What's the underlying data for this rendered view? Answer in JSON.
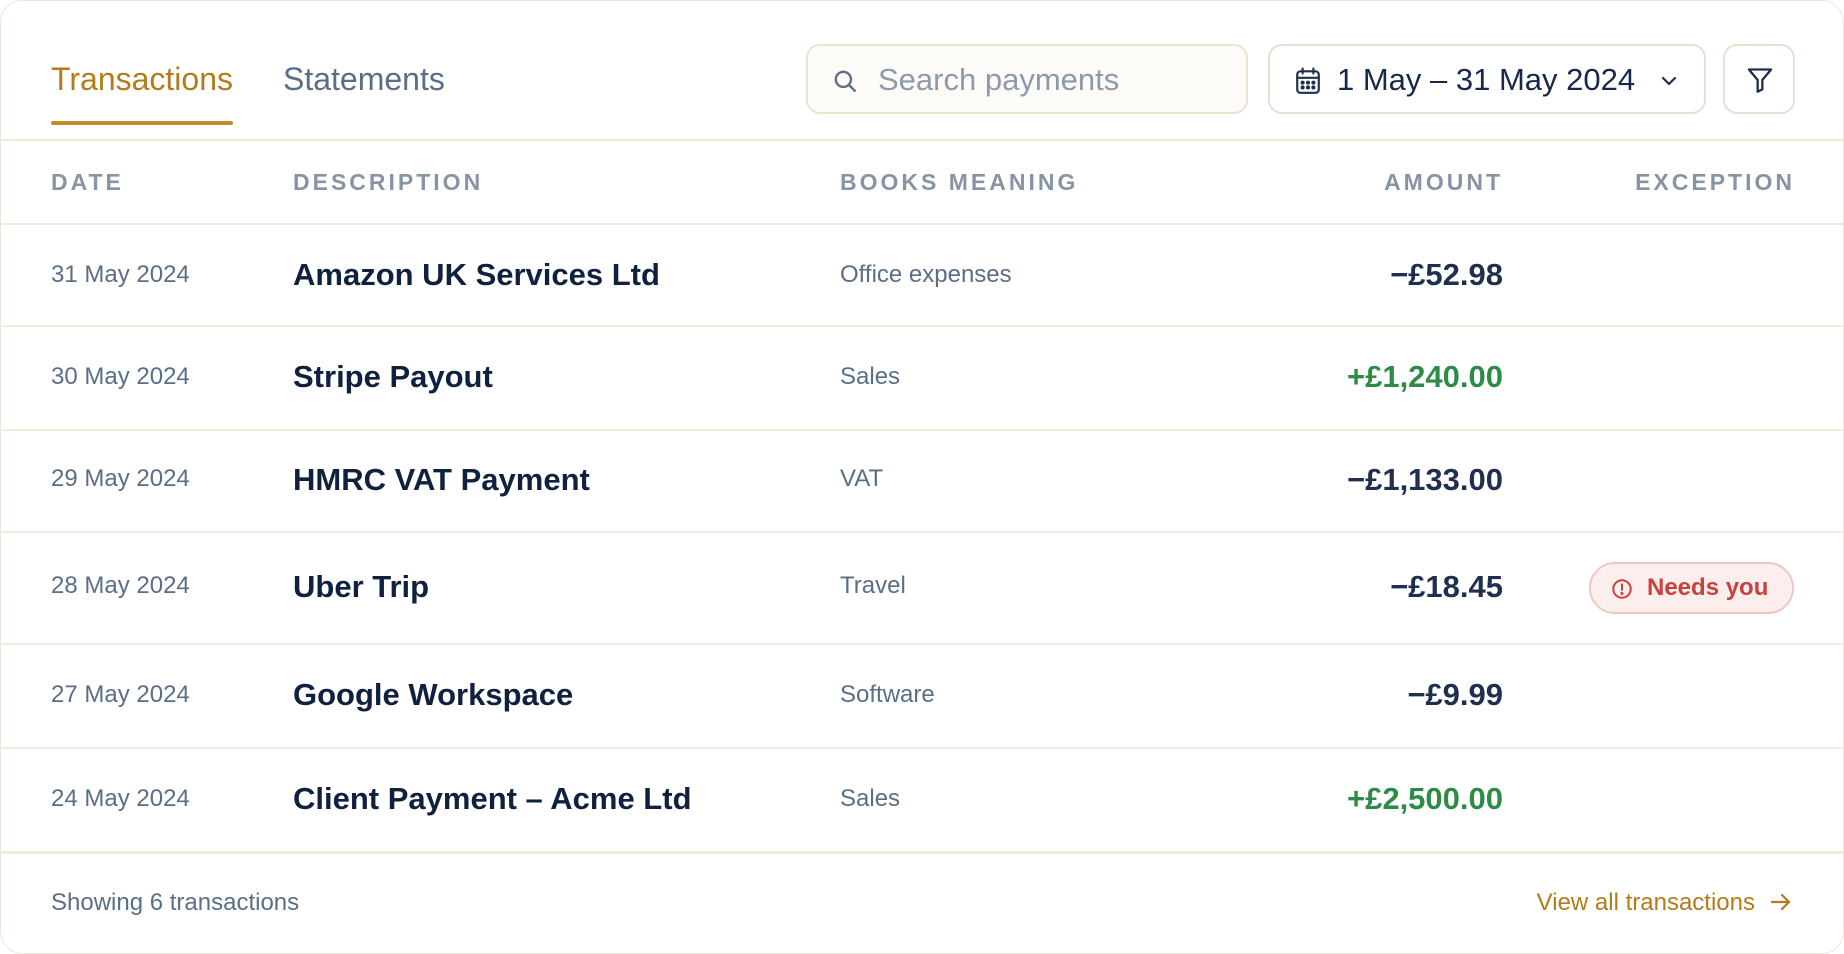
{
  "tabs": [
    {
      "label": "Transactions",
      "active": true
    },
    {
      "label": "Statements",
      "active": false
    }
  ],
  "search": {
    "placeholder": "Search payments",
    "icon": "search-icon"
  },
  "date_range": {
    "label": "1 May – 31 May 2024",
    "icon": "calendar-icon"
  },
  "filter": {
    "icon": "filter-icon"
  },
  "columns": {
    "date": "DATE",
    "description": "DESCRIPTION",
    "books_meaning": "BOOKS MEANING",
    "amount": "AMOUNT",
    "exception": "EXCEPTION"
  },
  "transactions": [
    {
      "date": "31 May 2024",
      "description": "Amazon UK Services Ltd",
      "books_meaning": "Office expenses",
      "amount": "−£52.98",
      "direction": "out",
      "exception": ""
    },
    {
      "date": "30 May 2024",
      "description": "Stripe Payout",
      "books_meaning": "Sales",
      "amount": "+£1,240.00",
      "direction": "in",
      "exception": ""
    },
    {
      "date": "29 May 2024",
      "description": "HMRC VAT Payment",
      "books_meaning": "VAT",
      "amount": "−£1,133.00",
      "direction": "out",
      "exception": ""
    },
    {
      "date": "28 May 2024",
      "description": "Uber Trip",
      "books_meaning": "Travel",
      "amount": "−£18.45",
      "direction": "out",
      "exception": "Needs you"
    },
    {
      "date": "27 May 2024",
      "description": "Google Workspace",
      "books_meaning": "Software",
      "amount": "−£9.99",
      "direction": "out",
      "exception": ""
    },
    {
      "date": "24 May 2024",
      "description": "Client Payment – Acme Ltd",
      "books_meaning": "Sales",
      "amount": "+£2,500.00",
      "direction": "in",
      "exception": ""
    }
  ],
  "footer": {
    "count_text": "Showing 6 transactions",
    "view_all_label": "View all transactions"
  },
  "colors": {
    "accent": "#b37b1a",
    "positive": "#2e8b47",
    "negative": "#1f2f4d",
    "exception": "#c8403f"
  }
}
